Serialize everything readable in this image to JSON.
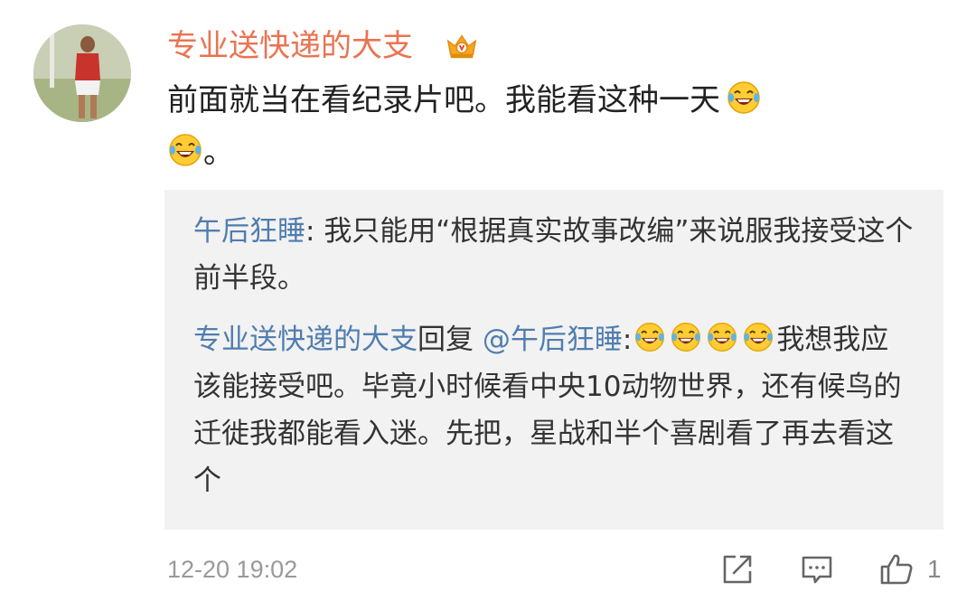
{
  "comment": {
    "username": "专业送快递的大支",
    "body_part1": "前面就当在看纪录片吧。我能看这种一天",
    "body_part2": "。"
  },
  "quote": {
    "author1": "午后狂睡",
    "sep1": ": ",
    "text1": "我只能用“根据真实故事改编”来说服我接受这个前半段。",
    "author2": "专业送快递的大支",
    "reply_word": "回复",
    "mention": "@午后狂睡",
    "sep2": ":",
    "text2": "我想我应该能接受吧。毕竟小时候看中央10动物世界，还有候鸟的迁徙我都能看入迷。先把，星战和半个喜剧看了再去看这个"
  },
  "footer": {
    "timestamp": "12-20 19:02",
    "like_count": "1"
  },
  "icons": {
    "crown": "vip-crown-icon",
    "emoji": "laughing-tears-emoji",
    "share": "share-icon",
    "comment": "comment-icon",
    "like": "thumbs-up-icon"
  },
  "colors": {
    "username": "#eb7350",
    "link": "#507daf",
    "quote_bg": "#f2f2f2",
    "meta": "#999999"
  }
}
